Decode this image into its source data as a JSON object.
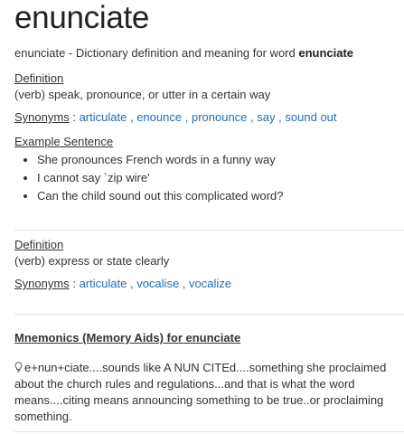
{
  "word": "enunciate",
  "summary": {
    "prefix": "enunciate - Dictionary definition and meaning for word ",
    "word": "enunciate"
  },
  "definitions": [
    {
      "definition_label": "Definition",
      "definition_text": "(verb) speak, pronounce, or utter in a certain way",
      "synonyms_label": "Synonyms",
      "synonyms": [
        "articulate",
        "enounce",
        "pronounce",
        "say",
        "sound out"
      ],
      "example_label": "Example Sentence",
      "examples": [
        "She pronounces French words in a funny way",
        "I cannot say `zip wire'",
        "Can the child sound out this complicated word?"
      ]
    },
    {
      "definition_label": "Definition",
      "definition_text": "(verb) express or state clearly",
      "synonyms_label": "Synonyms",
      "synonyms": [
        "articulate",
        "vocalise",
        "vocalize"
      ]
    }
  ],
  "mnemonics": {
    "title": "Mnemonics (Memory Aids) for enunciate",
    "icon": "lightbulb-icon",
    "text": "e+nun+ciate....sounds like A NUN CITEd....something she proclaimed about the church rules and regulations...and that is what the word means....citing means announcing something to be true..or proclaiming something."
  },
  "colors": {
    "link": "#1f6fb2",
    "text": "#333333",
    "divider": "#e3e3e3"
  }
}
